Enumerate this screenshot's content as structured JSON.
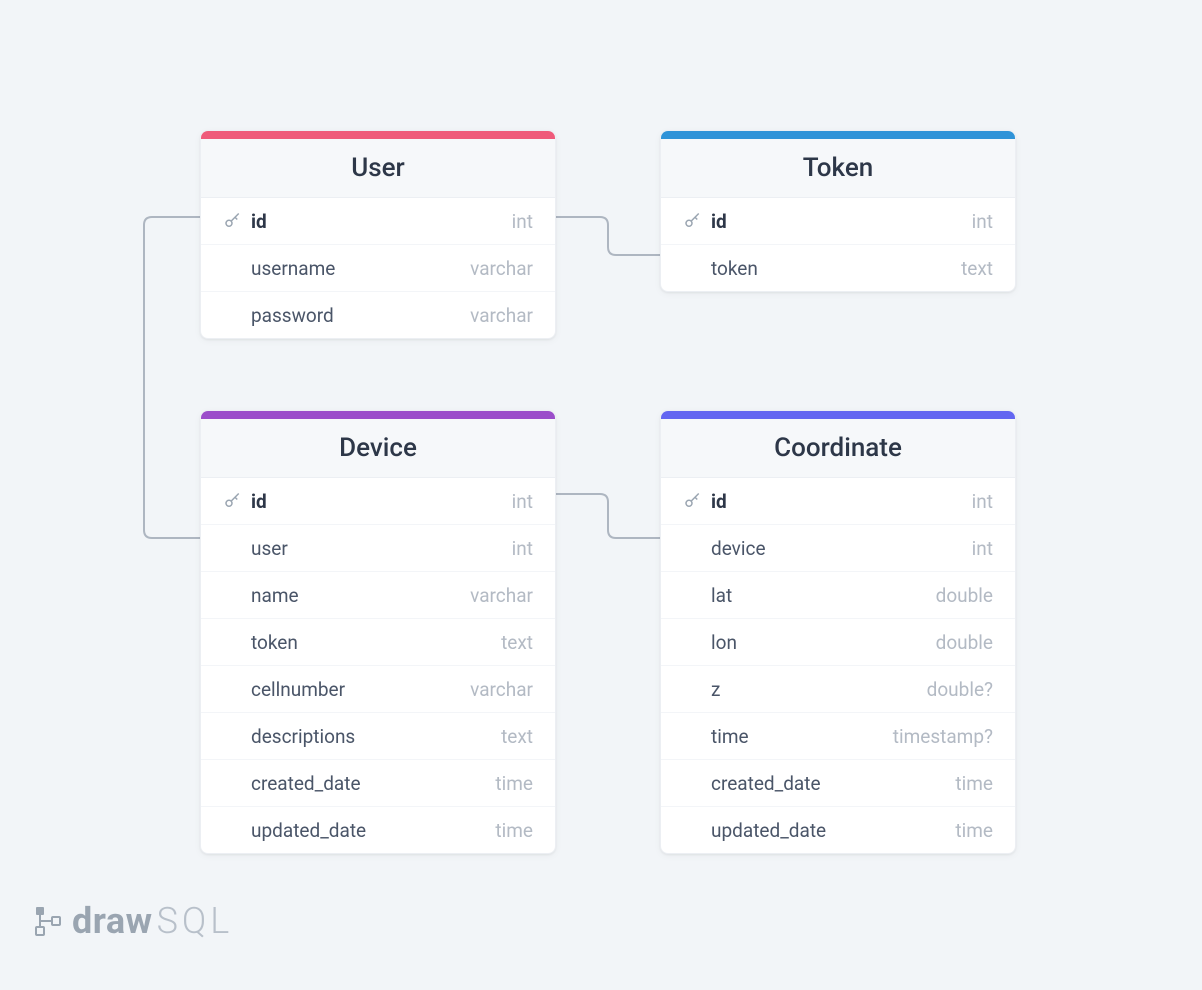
{
  "logo": {
    "part1": "draw",
    "part2": "SQL"
  },
  "tables": {
    "user": {
      "title": "User",
      "accent": "#ef5a7a",
      "columns": [
        {
          "name": "id",
          "type": "int",
          "pk": true
        },
        {
          "name": "username",
          "type": "varchar",
          "pk": false
        },
        {
          "name": "password",
          "type": "varchar",
          "pk": false
        }
      ]
    },
    "token": {
      "title": "Token",
      "accent": "#2f93d8",
      "columns": [
        {
          "name": "id",
          "type": "int",
          "pk": true
        },
        {
          "name": "token",
          "type": "text",
          "pk": false
        }
      ]
    },
    "device": {
      "title": "Device",
      "accent": "#9b4dca",
      "columns": [
        {
          "name": "id",
          "type": "int",
          "pk": true
        },
        {
          "name": "user",
          "type": "int",
          "pk": false
        },
        {
          "name": "name",
          "type": "varchar",
          "pk": false
        },
        {
          "name": "token",
          "type": "text",
          "pk": false
        },
        {
          "name": "cellnumber",
          "type": "varchar",
          "pk": false
        },
        {
          "name": "descriptions",
          "type": "text",
          "pk": false
        },
        {
          "name": "created_date",
          "type": "time",
          "pk": false
        },
        {
          "name": "updated_date",
          "type": "time",
          "pk": false
        }
      ]
    },
    "coordinate": {
      "title": "Coordinate",
      "accent": "#6366f1",
      "columns": [
        {
          "name": "id",
          "type": "int",
          "pk": true
        },
        {
          "name": "device",
          "type": "int",
          "pk": false
        },
        {
          "name": "lat",
          "type": "double",
          "pk": false
        },
        {
          "name": "lon",
          "type": "double",
          "pk": false
        },
        {
          "name": "z",
          "type": "double?",
          "pk": false
        },
        {
          "name": "time",
          "type": "timestamp?",
          "pk": false
        },
        {
          "name": "created_date",
          "type": "time",
          "pk": false
        },
        {
          "name": "updated_date",
          "type": "time",
          "pk": false
        }
      ]
    }
  },
  "relations": [
    {
      "from": "user.id",
      "to": "token.id"
    },
    {
      "from": "user.id",
      "to": "device.user"
    },
    {
      "from": "device.id",
      "to": "coordinate.device"
    }
  ]
}
